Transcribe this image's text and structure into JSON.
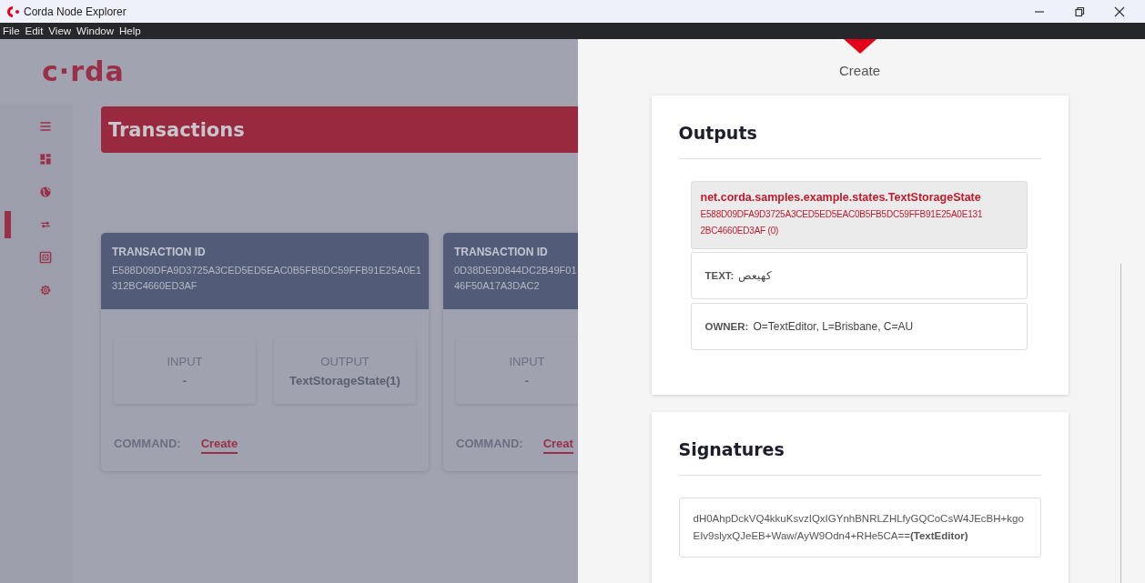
{
  "window": {
    "title": "Corda Node Explorer"
  },
  "menu": [
    "File",
    "Edit",
    "View",
    "Window",
    "Help"
  ],
  "logo": {
    "text": "c·rda"
  },
  "sidebar": {
    "items": [
      {
        "kind": "menu",
        "selected": false
      },
      {
        "kind": "dashboard",
        "selected": false
      },
      {
        "kind": "globe",
        "selected": false
      },
      {
        "kind": "transfer",
        "selected": true
      },
      {
        "kind": "vault",
        "selected": false
      },
      {
        "kind": "settings",
        "selected": false
      }
    ]
  },
  "page": {
    "title": "Transactions"
  },
  "transactions": [
    {
      "id_label": "TRANSACTION ID",
      "id_lines": [
        "E588D09DFA9D3725A3CED5ED5EAC0B5FB5DC59FFB91E25A0E1",
        "312BC4660ED3AF"
      ],
      "boxes": [
        {
          "label": "INPUT",
          "value": "-"
        },
        {
          "label": "OUTPUT",
          "value": "TextStorageState(1)"
        }
      ],
      "command_label": "COMMAND:",
      "command": "Create"
    },
    {
      "id_label": "TRANSACTION ID",
      "id_lines": [
        "0D38DE9D844DC2B49F01",
        "46F50A17A3DAC2"
      ],
      "boxes": [
        {
          "label": "INPUT",
          "value": "-"
        }
      ],
      "command_label": "COMMAND:",
      "command": "Creat"
    }
  ],
  "drawer": {
    "title": "Create",
    "outputs": {
      "title": "Outputs",
      "state": {
        "class_name": "net.corda.samples.example.states.TextStorageState",
        "ref_lines": [
          "E588D09DFA9D3725A3CED5ED5EAC0B5FB5DC59FFB91E25A0E131",
          "2BC4660ED3AF (0)"
        ]
      },
      "fields": [
        {
          "label": "TEXT:",
          "value": "كهيعص"
        },
        {
          "label": "OWNER:",
          "value": "O=TextEditor, L=Brisbane, C=AU"
        }
      ]
    },
    "signatures": {
      "title": "Signatures",
      "items": [
        "dH0AhpDckVQ4kkuKsvzIQxIGYnhBNRLZHLfyGQCoCsW4JEcBH+kgoEIv9slyxQJeEB+Waw/AyW9Odn4+RHe5CA==**(TextEditor)**"
      ]
    }
  }
}
